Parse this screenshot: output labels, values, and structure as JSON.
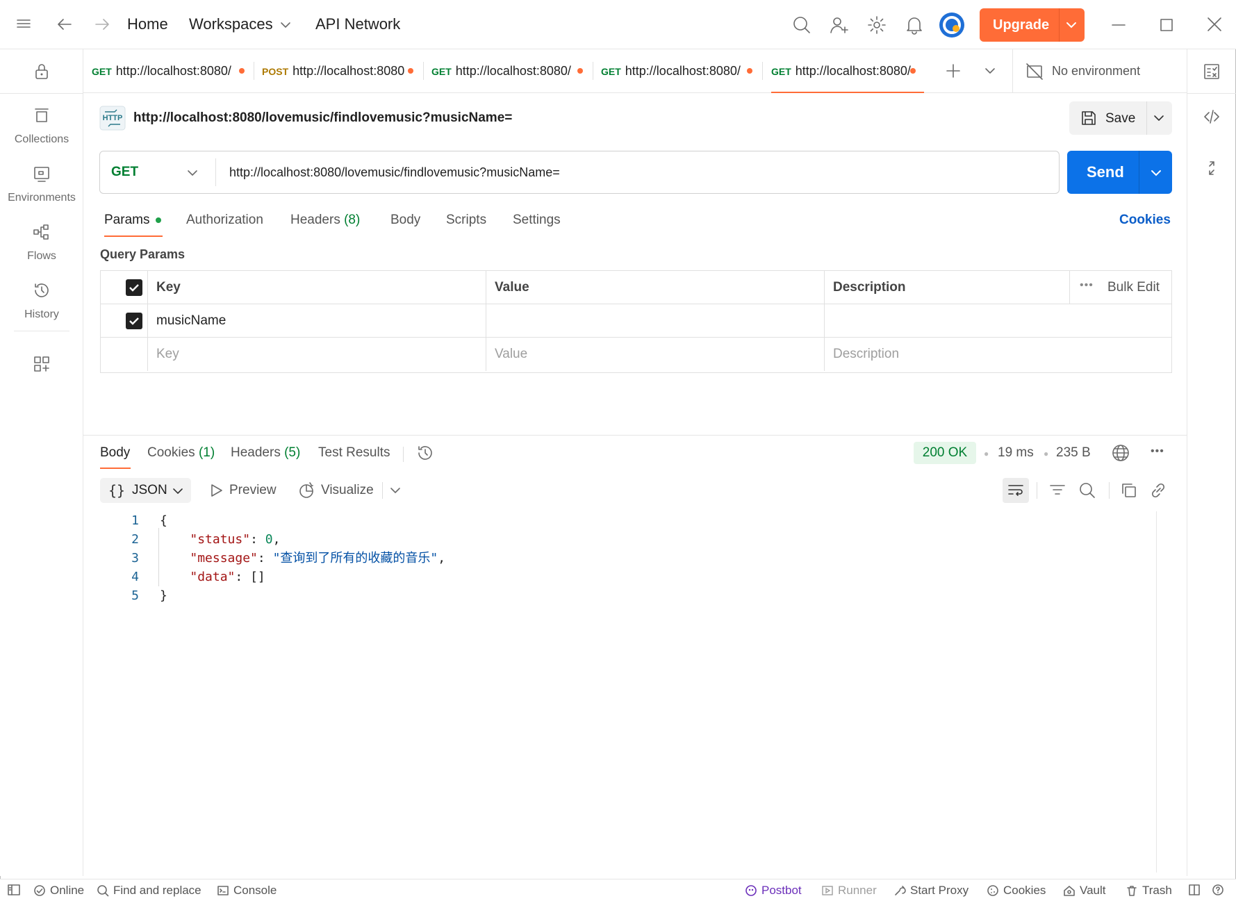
{
  "titlebar": {
    "nav": [
      "Home",
      "Workspaces",
      "API Network"
    ],
    "upgrade_label": "Upgrade"
  },
  "sidebar": {
    "items": [
      {
        "label": "Collections",
        "icon": "collections-icon"
      },
      {
        "label": "Environments",
        "icon": "environments-icon"
      },
      {
        "label": "Flows",
        "icon": "flows-icon"
      },
      {
        "label": "History",
        "icon": "history-icon"
      }
    ]
  },
  "tabs": [
    {
      "method": "GET",
      "url": "http://localhost:8080/",
      "unsaved": true
    },
    {
      "method": "POST",
      "url": "http://localhost:8080",
      "unsaved": true
    },
    {
      "method": "GET",
      "url": "http://localhost:8080/",
      "unsaved": true
    },
    {
      "method": "GET",
      "url": "http://localhost:8080/",
      "unsaved": true
    },
    {
      "method": "GET",
      "url": "http://localhost:8080/",
      "unsaved": true,
      "active": true
    }
  ],
  "environment": "No environment",
  "request": {
    "name": "http://localhost:8080/lovemusic/findlovemusic?musicName=",
    "save_label": "Save",
    "method": "GET",
    "url": "http://localhost:8080/lovemusic/findlovemusic?musicName=",
    "send_label": "Send"
  },
  "request_tabs": {
    "params": "Params",
    "authorization": "Authorization",
    "headers": "Headers",
    "headers_count": "(8)",
    "body": "Body",
    "scripts": "Scripts",
    "settings": "Settings",
    "cookies": "Cookies"
  },
  "query_params": {
    "title": "Query Params",
    "headers": {
      "key": "Key",
      "value": "Value",
      "description": "Description",
      "bulk_edit": "Bulk Edit"
    },
    "rows": [
      {
        "checked": true,
        "key": "musicName",
        "value": "",
        "description": ""
      }
    ],
    "placeholders": {
      "key": "Key",
      "value": "Value",
      "description": "Description"
    }
  },
  "response": {
    "tabs": {
      "body": "Body",
      "cookies": "Cookies",
      "cookies_count": "(1)",
      "headers": "Headers",
      "headers_count": "(5)",
      "test_results": "Test Results"
    },
    "status": "200 OK",
    "time": "19 ms",
    "size": "235 B",
    "format": "JSON",
    "preview": "Preview",
    "visualize": "Visualize",
    "lines": [
      "1",
      "2",
      "3",
      "4",
      "5"
    ],
    "json": {
      "open": "{",
      "status_key": "\"status\"",
      "status_val": "0",
      "message_key": "\"message\"",
      "message_val": "\"查询到了所有的收藏的音乐\"",
      "data_key": "\"data\"",
      "data_val": "[]",
      "close": "}"
    }
  },
  "statusbar": {
    "online": "Online",
    "find_replace": "Find and replace",
    "console": "Console",
    "postbot": "Postbot",
    "runner": "Runner",
    "start_proxy": "Start Proxy",
    "cookies": "Cookies",
    "vault": "Vault",
    "trash": "Trash"
  },
  "colors": {
    "accent": "#ff6c37",
    "send": "#0c72e8",
    "get": "#007f31",
    "post": "#ad7a03",
    "postbot": "#6b2fba"
  }
}
